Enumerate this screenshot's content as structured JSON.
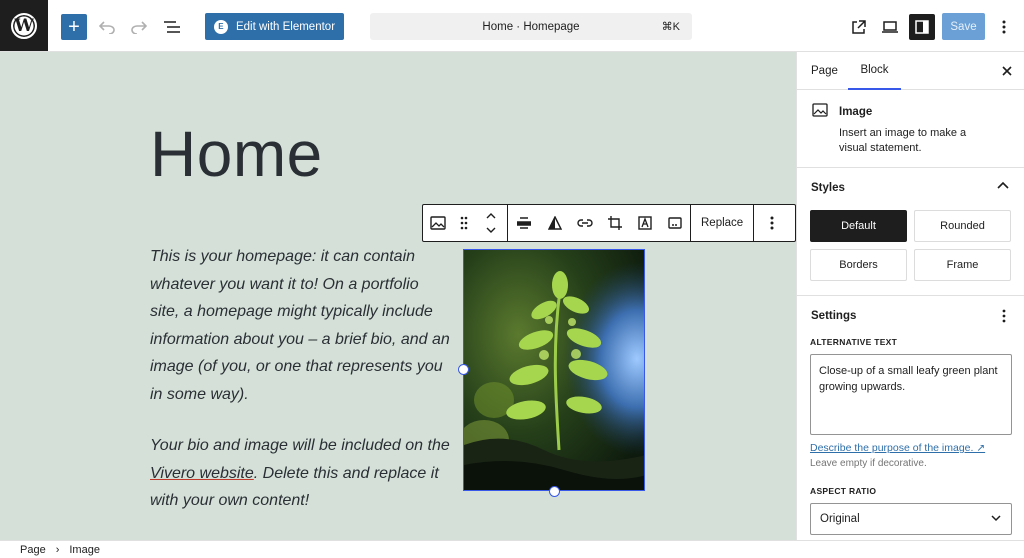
{
  "topbar": {
    "add_label": "+",
    "elementor_label": "Edit with Elementor",
    "document_title": "Home · Homepage",
    "shortcut": "⌘K",
    "save_label": "Save"
  },
  "canvas": {
    "title": "Home",
    "paragraph1": "This is your homepage: it can contain whatever you want it to! On a portfolio site, a homepage might typically include information about you – a brief bio, and an image (of you, or one that represents you in some way).",
    "paragraph2_before": "Your bio and image will be included on the ",
    "paragraph2_link": "Vivero website",
    "paragraph2_after": ". Delete this and replace it with your own content!"
  },
  "block_toolbar": {
    "replace_label": "Replace",
    "icons": [
      "image-icon",
      "drag-handle-icon",
      "move-up-down-icon",
      "align-icon",
      "duotone-icon",
      "link-icon",
      "crop-icon",
      "text-overlay-icon",
      "caption-icon",
      "more-options-icon"
    ]
  },
  "sidebar": {
    "tab_page": "Page",
    "tab_block": "Block",
    "block_name": "Image",
    "block_description": "Insert an image to make a visual statement.",
    "styles_title": "Styles",
    "styles": [
      "Default",
      "Rounded",
      "Borders",
      "Frame"
    ],
    "active_style": "Default",
    "settings_title": "Settings",
    "alt_label": "ALTERNATIVE TEXT",
    "alt_value": "Close-up of a small leafy green plant growing upwards.",
    "describe_link": "Describe the purpose of the image. ↗",
    "help_text": "Leave empty if decorative.",
    "aspect_label": "ASPECT RATIO",
    "aspect_value": "Original"
  },
  "footer": {
    "crumb1": "Page",
    "separator": "›",
    "crumb2": "Image"
  },
  "colors": {
    "accent": "#2f6fa9",
    "canvas_bg": "#d5e1d8",
    "selection": "#3858e9",
    "dark": "#1e1e1e"
  }
}
